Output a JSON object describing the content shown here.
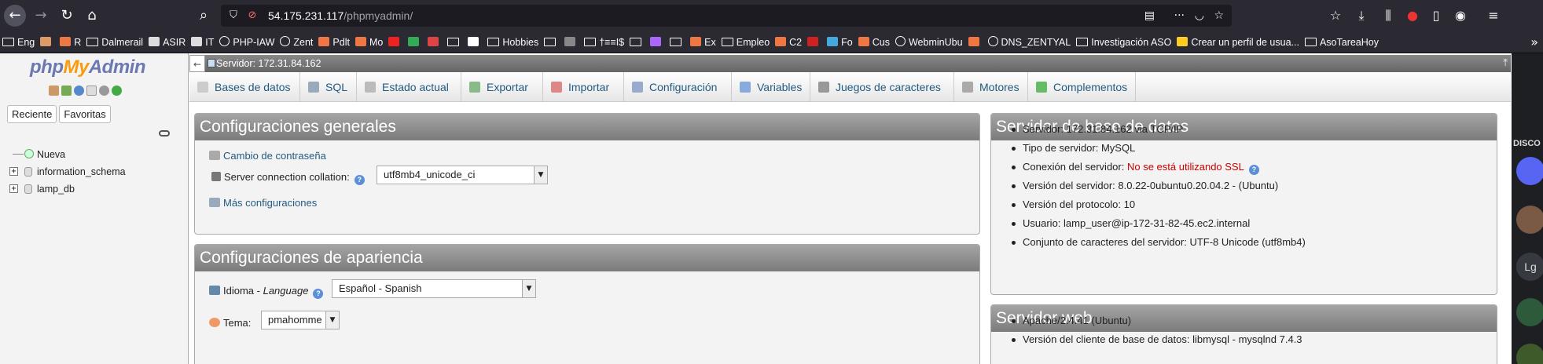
{
  "browser": {
    "url_host": "54.175.231.117",
    "url_path": "/phpmyadmin/",
    "bookmarks": [
      {
        "label": "Eng",
        "icon": "folder"
      },
      {
        "label": "",
        "icon": "dancer"
      },
      {
        "label": "R",
        "icon": "logo"
      },
      {
        "label": "Dalmerail",
        "icon": "folder"
      },
      {
        "label": "ASIR",
        "icon": "doc"
      },
      {
        "label": "IT",
        "icon": "doc"
      },
      {
        "label": "PHP-IAW",
        "icon": "globe"
      },
      {
        "label": "Zent",
        "icon": "globe"
      },
      {
        "label": "Pdlt",
        "icon": "logo"
      },
      {
        "label": "Mo",
        "icon": "logo"
      },
      {
        "label": "",
        "icon": "red-circle"
      },
      {
        "label": "",
        "icon": "drive"
      },
      {
        "label": "",
        "icon": "gmail"
      },
      {
        "label": "",
        "icon": "folder"
      },
      {
        "label": "",
        "icon": "dot"
      },
      {
        "label": "Hobbies",
        "icon": "folder"
      },
      {
        "label": "",
        "icon": "folder"
      },
      {
        "label": "",
        "icon": "game"
      },
      {
        "label": "†≡≡I$",
        "icon": "folder"
      },
      {
        "label": "",
        "icon": "folder"
      },
      {
        "label": "",
        "icon": "music"
      },
      {
        "label": "",
        "icon": "folder"
      },
      {
        "label": "Ex",
        "icon": "logo"
      },
      {
        "label": "Empleo",
        "icon": "folder"
      },
      {
        "label": "C2",
        "icon": "logo"
      },
      {
        "label": "",
        "icon": "cat"
      },
      {
        "label": "Fo",
        "icon": "drop"
      },
      {
        "label": "Cus",
        "icon": "logo"
      },
      {
        "label": "WebminUbu",
        "icon": "globe"
      },
      {
        "label": "",
        "icon": "logo"
      },
      {
        "label": "DNS_ZENTYAL",
        "icon": "globe"
      },
      {
        "label": "Investigación ASO",
        "icon": "folder"
      },
      {
        "label": "Crear un perfil de usua...",
        "icon": "bulb"
      },
      {
        "label": "AsoTareaHoy",
        "icon": "folder"
      }
    ]
  },
  "pma": {
    "logo": {
      "php": "php",
      "my": "My",
      "admin": "Admin"
    },
    "nav_tabs": [
      "Reciente",
      "Favoritas"
    ],
    "tree": [
      "Nueva",
      "information_schema",
      "lamp_db"
    ],
    "server_label": "Servidor: 172.31.84.162",
    "tabs": [
      "Bases de datos",
      "SQL",
      "Estado actual",
      "Exportar",
      "Importar",
      "Configuración",
      "Variables",
      "Juegos de caracteres",
      "Motores",
      "Complementos"
    ],
    "general": {
      "title": "Configuraciones generales",
      "change_password": "Cambio de contraseña",
      "collation_label": "Server connection collation:",
      "collation_value": "utf8mb4_unicode_ci",
      "more_settings": "Más configuraciones"
    },
    "appearance": {
      "title": "Configuraciones de apariencia",
      "lang_label": "Idioma",
      "lang_sep": " - ",
      "lang_label_en": "Language",
      "lang_value": "Español - Spanish",
      "theme_label": "Tema:",
      "theme_value": "pmahomme"
    },
    "db_server": {
      "title": "Servidor de base de datos",
      "items": [
        "Servidor: 172.31.84.162 via TCP/IP",
        "Tipo de servidor: MySQL",
        "Conexión del servidor: ",
        "Versión del servidor: 8.0.22-0ubuntu0.20.04.2 - (Ubuntu)",
        "Versión del protocolo: 10",
        "Usuario: lamp_user@ip-172-31-82-45.ec2.internal",
        "Conjunto de caracteres del servidor: UTF-8 Unicode (utf8mb4)"
      ],
      "ssl_warning": "No se está utilizando SSL"
    },
    "web_server": {
      "title": "Servidor web",
      "items": [
        "Apache/2.4.41 (Ubuntu)",
        "Versión del cliente de base de datos: libmysql - mysqlnd 7.4.3"
      ]
    }
  },
  "discord": {
    "label": "DISCO",
    "badge": "Lg"
  }
}
